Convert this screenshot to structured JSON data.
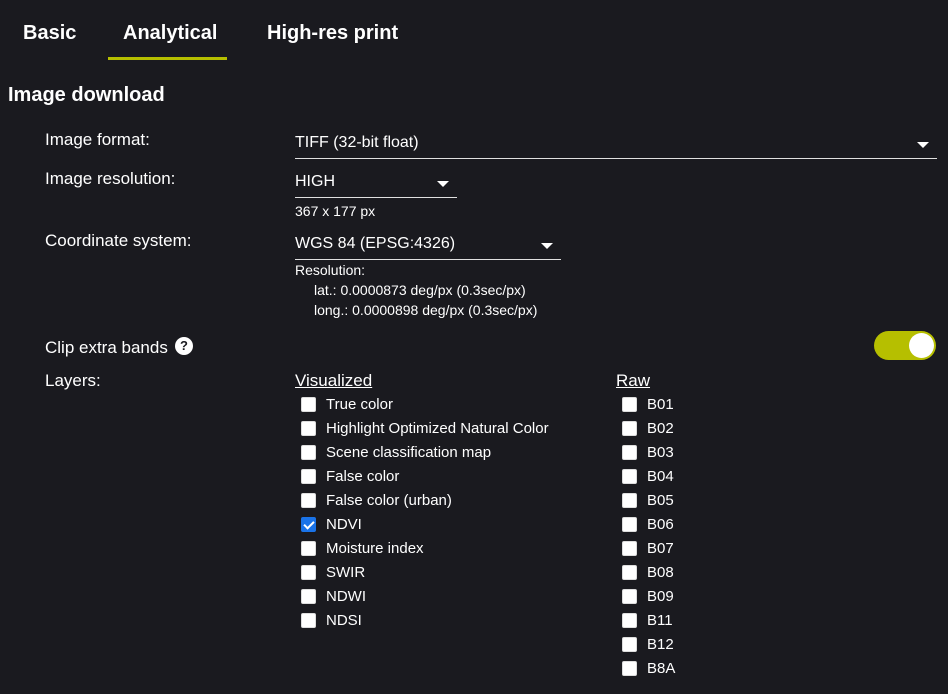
{
  "tabs": [
    {
      "label": "Basic",
      "active": false
    },
    {
      "label": "Analytical",
      "active": true
    },
    {
      "label": "High-res print",
      "active": false
    }
  ],
  "section_title": "Image download",
  "format": {
    "label": "Image format:",
    "value": "TIFF (32-bit float)"
  },
  "resolution": {
    "label": "Image resolution:",
    "value": "HIGH",
    "size": "367 x 177 px"
  },
  "crs": {
    "label": "Coordinate system:",
    "value": "WGS 84 (EPSG:4326)",
    "res_title": "Resolution:",
    "lat": "lat.: 0.0000873 deg/px (0.3sec/px)",
    "long": "long.: 0.0000898 deg/px (0.3sec/px)"
  },
  "clip": {
    "label": "Clip extra bands",
    "help_icon": "question-circle-icon",
    "enabled": true
  },
  "layers": {
    "label": "Layers:",
    "visualized_title": "Visualized",
    "raw_title": "Raw",
    "visualized": [
      {
        "label": "True color",
        "checked": false
      },
      {
        "label": "Highlight Optimized Natural Color",
        "checked": false
      },
      {
        "label": "Scene classification map",
        "checked": false
      },
      {
        "label": "False color",
        "checked": false
      },
      {
        "label": "False color (urban)",
        "checked": false
      },
      {
        "label": "NDVI",
        "checked": true
      },
      {
        "label": "Moisture index",
        "checked": false
      },
      {
        "label": "SWIR",
        "checked": false
      },
      {
        "label": "NDWI",
        "checked": false
      },
      {
        "label": "NDSI",
        "checked": false
      }
    ],
    "raw": [
      {
        "label": "B01",
        "checked": false
      },
      {
        "label": "B02",
        "checked": false
      },
      {
        "label": "B03",
        "checked": false
      },
      {
        "label": "B04",
        "checked": false
      },
      {
        "label": "B05",
        "checked": false
      },
      {
        "label": "B06",
        "checked": false
      },
      {
        "label": "B07",
        "checked": false
      },
      {
        "label": "B08",
        "checked": false
      },
      {
        "label": "B09",
        "checked": false
      },
      {
        "label": "B11",
        "checked": false
      },
      {
        "label": "B12",
        "checked": false
      },
      {
        "label": "B8A",
        "checked": false
      }
    ]
  },
  "colors": {
    "accent": "#b6bf00",
    "background": "#1a1a1f",
    "checkbox_checked": "#1a73e8"
  }
}
